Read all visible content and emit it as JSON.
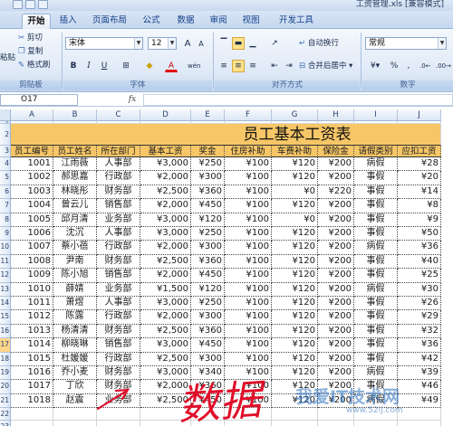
{
  "window": {
    "title": "工资管理.xls [兼容模式]"
  },
  "tabs": [
    "开始",
    "插入",
    "页面布局",
    "公式",
    "数据",
    "审阅",
    "视图",
    "开发工具"
  ],
  "ribbon": {
    "clipboard": {
      "cut": "剪切",
      "copy": "复制",
      "format_painter": "格式刷",
      "paste": "粘贴",
      "label": "剪贴板"
    },
    "font": {
      "name": "宋体",
      "size": "12",
      "label": "字体",
      "bold": "B",
      "italic": "I",
      "underline": "U",
      "font_color": "A",
      "phonetic": "wén",
      "grow": "A",
      "shrink": "A"
    },
    "alignment": {
      "wrap": "自动换行",
      "merge": "合并后居中",
      "label": "对齐方式"
    },
    "number": {
      "format": "常规",
      "percent": "%",
      "comma": ",",
      "label": "数字"
    }
  },
  "formula_bar": {
    "name_box": "O17",
    "fx": "fx",
    "value": ""
  },
  "columns": [
    "A",
    "B",
    "C",
    "D",
    "E",
    "F",
    "G",
    "H",
    "I",
    "J"
  ],
  "sheet": {
    "title": "员工基本工资表",
    "headers": [
      "员工编号",
      "员工姓名",
      "所在部门",
      "基本工资",
      "奖金",
      "住房补助",
      "车费补助",
      "保险金",
      "请假类别",
      "应扣工资"
    ],
    "rows": [
      [
        "1001",
        "江雨薇",
        "人事部",
        "¥3,000",
        "¥250",
        "¥100",
        "¥120",
        "¥200",
        "病假",
        "¥28"
      ],
      [
        "1002",
        "郝思嘉",
        "行政部",
        "¥2,000",
        "¥300",
        "¥100",
        "¥120",
        "¥200",
        "事假",
        "¥20"
      ],
      [
        "1003",
        "林晓彤",
        "财务部",
        "¥2,500",
        "¥360",
        "¥100",
        "¥0",
        "¥220",
        "事假",
        "¥14"
      ],
      [
        "1004",
        "曾云儿",
        "销售部",
        "¥2,000",
        "¥450",
        "¥100",
        "¥120",
        "¥200",
        "事假",
        "¥8"
      ],
      [
        "1005",
        "邱月清",
        "业务部",
        "¥3,000",
        "¥120",
        "¥100",
        "¥0",
        "¥200",
        "事假",
        "¥9"
      ],
      [
        "1006",
        "沈沉",
        "人事部",
        "¥3,000",
        "¥250",
        "¥100",
        "¥120",
        "¥200",
        "事假",
        "¥50"
      ],
      [
        "1007",
        "蔡小蓓",
        "行政部",
        "¥2,000",
        "¥300",
        "¥100",
        "¥120",
        "¥200",
        "病假",
        "¥36"
      ],
      [
        "1008",
        "尹南",
        "财务部",
        "¥2,500",
        "¥360",
        "¥100",
        "¥120",
        "¥200",
        "事假",
        "¥40"
      ],
      [
        "1009",
        "陈小旭",
        "销售部",
        "¥2,000",
        "¥450",
        "¥100",
        "¥120",
        "¥200",
        "事假",
        "¥25"
      ],
      [
        "1010",
        "薛婧",
        "业务部",
        "¥1,500",
        "¥120",
        "¥100",
        "¥120",
        "¥200",
        "病假",
        "¥30"
      ],
      [
        "1011",
        "萧煜",
        "人事部",
        "¥3,000",
        "¥250",
        "¥100",
        "¥120",
        "¥200",
        "事假",
        "¥26"
      ],
      [
        "1012",
        "陈露",
        "行政部",
        "¥2,000",
        "¥300",
        "¥100",
        "¥120",
        "¥200",
        "事假",
        "¥29"
      ],
      [
        "1013",
        "杨清清",
        "财务部",
        "¥2,500",
        "¥360",
        "¥100",
        "¥120",
        "¥200",
        "事假",
        "¥32"
      ],
      [
        "1014",
        "柳晓琳",
        "销售部",
        "¥3,000",
        "¥450",
        "¥100",
        "¥120",
        "¥200",
        "事假",
        "¥36"
      ],
      [
        "1015",
        "杜媛媛",
        "行政部",
        "¥2,500",
        "¥300",
        "¥100",
        "¥120",
        "¥200",
        "事假",
        "¥42"
      ],
      [
        "1016",
        "乔小麦",
        "财务部",
        "¥3,000",
        "¥340",
        "¥100",
        "¥120",
        "¥200",
        "病假",
        "¥39"
      ],
      [
        "1017",
        "丁欣",
        "财务部",
        "¥2,000",
        "¥360",
        "¥100",
        "¥120",
        "¥200",
        "事假",
        "¥46"
      ],
      [
        "1018",
        "赵震",
        "业务部",
        "¥2,500",
        "¥450",
        "¥100",
        "¥120",
        "¥200",
        "病假",
        "¥49"
      ]
    ]
  },
  "row_numbers": [
    "1",
    "2",
    "3",
    "4",
    "5",
    "6",
    "7",
    "8",
    "9",
    "10",
    "11",
    "12",
    "13",
    "14",
    "15",
    "16",
    "17",
    "18",
    "19",
    "20",
    "21",
    "22",
    "23"
  ],
  "annotation": {
    "handwriting": "数据"
  },
  "watermark": {
    "text": "我爱IT技术网",
    "url": "www.52ij.com"
  }
}
